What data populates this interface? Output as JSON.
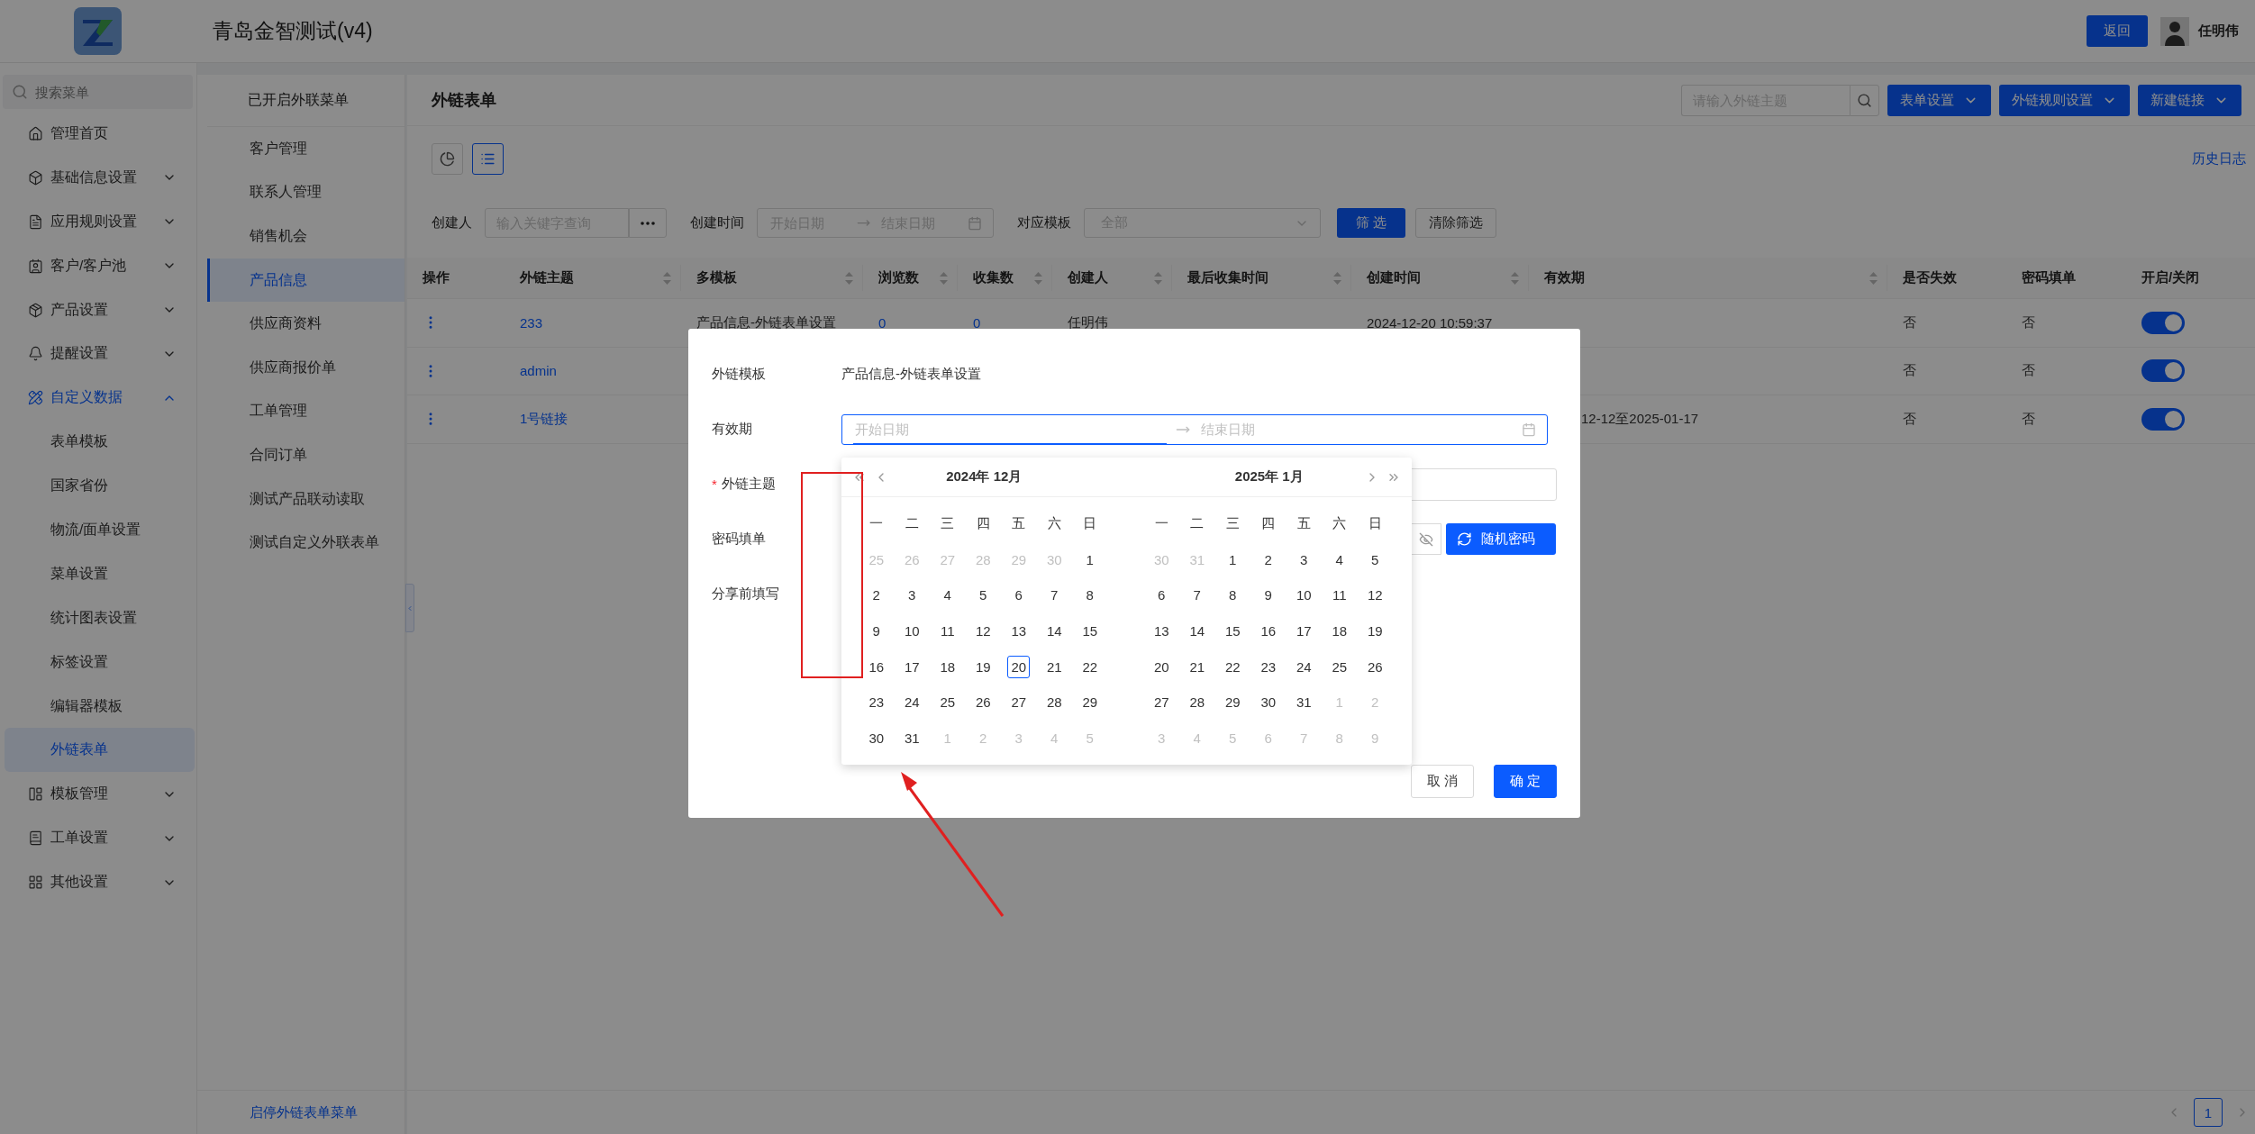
{
  "header": {
    "title": "青岛金智测试(v4)",
    "back_button": "返回",
    "user_name": "任明伟"
  },
  "sidebar": {
    "search_placeholder": "搜索菜单",
    "items": [
      {
        "label": "管理首页"
      },
      {
        "label": "基础信息设置",
        "expanded": false
      },
      {
        "label": "应用规则设置",
        "expanded": false
      },
      {
        "label": "客户/客户池",
        "expanded": false
      },
      {
        "label": "产品设置",
        "expanded": false
      },
      {
        "label": "提醒设置",
        "expanded": false
      },
      {
        "label": "自定义数据",
        "expanded": true,
        "children": [
          {
            "label": "表单模板",
            "selected": false
          },
          {
            "label": "国家省份",
            "selected": false
          },
          {
            "label": "物流/面单设置",
            "selected": false
          },
          {
            "label": "菜单设置",
            "selected": false
          },
          {
            "label": "统计图表设置",
            "selected": false
          },
          {
            "label": "标签设置",
            "selected": false
          },
          {
            "label": "编辑器模板",
            "selected": false
          },
          {
            "label": "外链表单",
            "selected": true
          }
        ]
      },
      {
        "label": "模板管理",
        "expanded": false
      },
      {
        "label": "工单设置",
        "expanded": false
      },
      {
        "label": "其他设置",
        "expanded": false
      }
    ]
  },
  "menu_panel": {
    "title": "已开启外联菜单",
    "items": [
      {
        "label": "客户管理",
        "selected": false
      },
      {
        "label": "联系人管理",
        "selected": false
      },
      {
        "label": "销售机会",
        "selected": false
      },
      {
        "label": "产品信息",
        "selected": true
      },
      {
        "label": "供应商资料",
        "selected": false
      },
      {
        "label": "供应商报价单",
        "selected": false
      },
      {
        "label": "工单管理",
        "selected": false
      },
      {
        "label": "合同订单",
        "selected": false
      },
      {
        "label": "测试产品联动读取",
        "selected": false
      },
      {
        "label": "测试自定义外联表单",
        "selected": false
      }
    ],
    "footer_link": "启停外链表单菜单"
  },
  "page": {
    "title": "外链表单",
    "search_placeholder": "请输入外链主题",
    "actions": [
      "表单设置",
      "外链规则设置",
      "新建链接"
    ],
    "view_modes": [
      {
        "selected": false
      },
      {
        "selected": true
      }
    ],
    "history_link": "历史日志"
  },
  "filters": {
    "creator_label": "创建人",
    "creator_placeholder": "输入关键字查询",
    "time_label": "创建时间",
    "start_placeholder": "开始日期",
    "end_placeholder": "结束日期",
    "template_label": "对应模板",
    "template_placeholder": "全部",
    "apply_button": "筛 选",
    "clear_button": "清除筛选"
  },
  "table": {
    "columns": [
      {
        "label": "操作",
        "sortable": false
      },
      {
        "label": "外链主题",
        "sortable": true
      },
      {
        "label": "多模板",
        "sortable": true
      },
      {
        "label": "浏览数",
        "sortable": true
      },
      {
        "label": "收集数",
        "sortable": true
      },
      {
        "label": "创建人",
        "sortable": true
      },
      {
        "label": "最后收集时间",
        "sortable": true
      },
      {
        "label": "创建时间",
        "sortable": true
      },
      {
        "label": "有效期",
        "sortable": true
      },
      {
        "label": "是否失效",
        "sortable": false
      },
      {
        "label": "密码填单",
        "sortable": false
      },
      {
        "label": "开启/关闭",
        "sortable": false
      }
    ],
    "rows": [
      {
        "topic": "233",
        "template": "产品信息-外链表单设置",
        "views": "0",
        "collections": "0",
        "creator": "任明伟",
        "created": "2024-12-20 10:59:37",
        "expired": "否",
        "password": "否",
        "enabled": true
      },
      {
        "topic": "admin",
        "expired": "否",
        "password": "否",
        "enabled": true
      },
      {
        "topic": "1号链接",
        "validity": "12-12至2025-01-17",
        "expired": "否",
        "password": "否",
        "enabled": true
      }
    ]
  },
  "pagination": {
    "pages": [
      {
        "label": "1",
        "selected": true
      }
    ]
  },
  "modal": {
    "fields": [
      {
        "kind": "text",
        "label": "外链模板",
        "value": "产品信息-外链表单设置"
      },
      {
        "kind": "date_range",
        "label": "有效期",
        "start_placeholder": "开始日期",
        "end_placeholder": "结束日期"
      },
      {
        "kind": "input",
        "label": "外链主题",
        "required_mark": "*"
      },
      {
        "kind": "password",
        "label": "密码填单",
        "button": "随机密码"
      },
      {
        "kind": "label_only",
        "label": "分享前填写"
      }
    ],
    "buttons": [
      {
        "label": "取 消",
        "primary": false
      },
      {
        "label": "确 定",
        "primary": true
      }
    ]
  },
  "date_picker": {
    "months": [
      {
        "title": "2024年 12月",
        "weekdays": [
          "一",
          "二",
          "三",
          "四",
          "五",
          "六",
          "日"
        ],
        "weeks": [
          [
            {
              "day": "25",
              "muted": true,
              "today": false
            },
            {
              "day": "26",
              "muted": true,
              "today": false
            },
            {
              "day": "27",
              "muted": true,
              "today": false
            },
            {
              "day": "28",
              "muted": true,
              "today": false
            },
            {
              "day": "29",
              "muted": true,
              "today": false
            },
            {
              "day": "30",
              "muted": true,
              "today": false
            },
            {
              "day": "1",
              "muted": false,
              "today": false
            }
          ],
          [
            {
              "day": "2",
              "muted": false,
              "today": false
            },
            {
              "day": "3",
              "muted": false,
              "today": false
            },
            {
              "day": "4",
              "muted": false,
              "today": false
            },
            {
              "day": "5",
              "muted": false,
              "today": false
            },
            {
              "day": "6",
              "muted": false,
              "today": false
            },
            {
              "day": "7",
              "muted": false,
              "today": false
            },
            {
              "day": "8",
              "muted": false,
              "today": false
            }
          ],
          [
            {
              "day": "9",
              "muted": false,
              "today": false
            },
            {
              "day": "10",
              "muted": false,
              "today": false
            },
            {
              "day": "11",
              "muted": false,
              "today": false
            },
            {
              "day": "12",
              "muted": false,
              "today": false
            },
            {
              "day": "13",
              "muted": false,
              "today": false
            },
            {
              "day": "14",
              "muted": false,
              "today": false
            },
            {
              "day": "15",
              "muted": false,
              "today": false
            }
          ],
          [
            {
              "day": "16",
              "muted": false,
              "today": false
            },
            {
              "day": "17",
              "muted": false,
              "today": false
            },
            {
              "day": "18",
              "muted": false,
              "today": false
            },
            {
              "day": "19",
              "muted": false,
              "today": false
            },
            {
              "day": "20",
              "muted": false,
              "today": true
            },
            {
              "day": "21",
              "muted": false,
              "today": false
            },
            {
              "day": "22",
              "muted": false,
              "today": false
            }
          ],
          [
            {
              "day": "23",
              "muted": false,
              "today": false
            },
            {
              "day": "24",
              "muted": false,
              "today": false
            },
            {
              "day": "25",
              "muted": false,
              "today": false
            },
            {
              "day": "26",
              "muted": false,
              "today": false
            },
            {
              "day": "27",
              "muted": false,
              "today": false
            },
            {
              "day": "28",
              "muted": false,
              "today": false
            },
            {
              "day": "29",
              "muted": false,
              "today": false
            }
          ],
          [
            {
              "day": "30",
              "muted": false,
              "today": false
            },
            {
              "day": "31",
              "muted": false,
              "today": false
            },
            {
              "day": "1",
              "muted": true,
              "today": false
            },
            {
              "day": "2",
              "muted": true,
              "today": false
            },
            {
              "day": "3",
              "muted": true,
              "today": false
            },
            {
              "day": "4",
              "muted": true,
              "today": false
            },
            {
              "day": "5",
              "muted": true,
              "today": false
            }
          ]
        ]
      },
      {
        "title": "2025年 1月",
        "weekdays": [
          "一",
          "二",
          "三",
          "四",
          "五",
          "六",
          "日"
        ],
        "weeks": [
          [
            {
              "day": "30",
              "muted": true,
              "today": false
            },
            {
              "day": "31",
              "muted": true,
              "today": false
            },
            {
              "day": "1",
              "muted": false,
              "today": false
            },
            {
              "day": "2",
              "muted": false,
              "today": false
            },
            {
              "day": "3",
              "muted": false,
              "today": false
            },
            {
              "day": "4",
              "muted": false,
              "today": false
            },
            {
              "day": "5",
              "muted": false,
              "today": false
            }
          ],
          [
            {
              "day": "6",
              "muted": false,
              "today": false
            },
            {
              "day": "7",
              "muted": false,
              "today": false
            },
            {
              "day": "8",
              "muted": false,
              "today": false
            },
            {
              "day": "9",
              "muted": false,
              "today": false
            },
            {
              "day": "10",
              "muted": false,
              "today": false
            },
            {
              "day": "11",
              "muted": false,
              "today": false
            },
            {
              "day": "12",
              "muted": false,
              "today": false
            }
          ],
          [
            {
              "day": "13",
              "muted": false,
              "today": false
            },
            {
              "day": "14",
              "muted": false,
              "today": false
            },
            {
              "day": "15",
              "muted": false,
              "today": false
            },
            {
              "day": "16",
              "muted": false,
              "today": false
            },
            {
              "day": "17",
              "muted": false,
              "today": false
            },
            {
              "day": "18",
              "muted": false,
              "today": false
            },
            {
              "day": "19",
              "muted": false,
              "today": false
            }
          ],
          [
            {
              "day": "20",
              "muted": false,
              "today": false
            },
            {
              "day": "21",
              "muted": false,
              "today": false
            },
            {
              "day": "22",
              "muted": false,
              "today": false
            },
            {
              "day": "23",
              "muted": false,
              "today": false
            },
            {
              "day": "24",
              "muted": false,
              "today": false
            },
            {
              "day": "25",
              "muted": false,
              "today": false
            },
            {
              "day": "26",
              "muted": false,
              "today": false
            }
          ],
          [
            {
              "day": "27",
              "muted": false,
              "today": false
            },
            {
              "day": "28",
              "muted": false,
              "today": false
            },
            {
              "day": "29",
              "muted": false,
              "today": false
            },
            {
              "day": "30",
              "muted": false,
              "today": false
            },
            {
              "day": "31",
              "muted": false,
              "today": false
            },
            {
              "day": "1",
              "muted": true,
              "today": false
            },
            {
              "day": "2",
              "muted": true,
              "today": false
            }
          ],
          [
            {
              "day": "3",
              "muted": true,
              "today": false
            },
            {
              "day": "4",
              "muted": true,
              "today": false
            },
            {
              "day": "5",
              "muted": true,
              "today": false
            },
            {
              "day": "6",
              "muted": true,
              "today": false
            },
            {
              "day": "7",
              "muted": true,
              "today": false
            },
            {
              "day": "8",
              "muted": true,
              "today": false
            },
            {
              "day": "9",
              "muted": true,
              "today": false
            }
          ]
        ]
      }
    ]
  },
  "annotations": [
    {
      "kind": "frame",
      "color": "#e02020"
    },
    {
      "kind": "arrow",
      "color": "#e02020"
    }
  ]
}
